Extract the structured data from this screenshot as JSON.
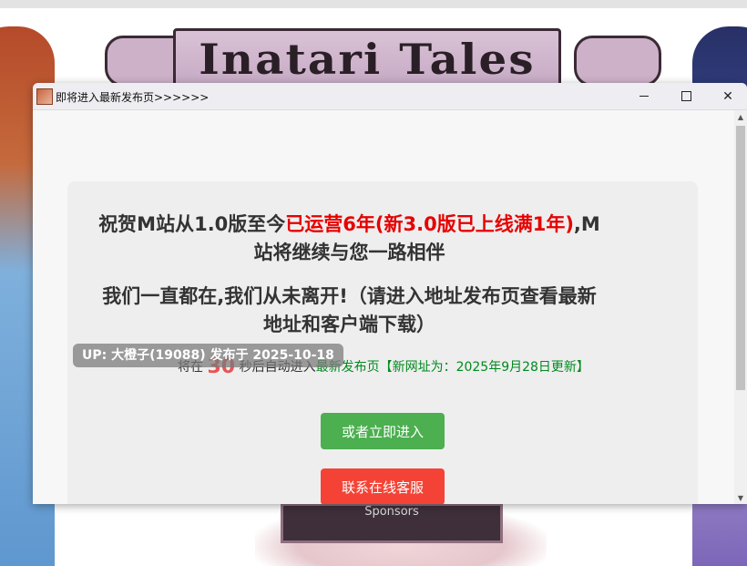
{
  "background": {
    "banner_title": "Inatari Tales",
    "bottom_text": "Sponsors"
  },
  "window": {
    "title": "即将进入最新发布页>>>>>>",
    "controls": {
      "minimize": "–",
      "maximize": "□",
      "close": "✕"
    }
  },
  "content": {
    "headline1_a": "祝贺M站从1.0版至今",
    "headline1_b": "已运营6年(新3.0版已上线满1年)",
    "headline1_c": ",M站将继续与您一路相伴",
    "headline2": "我们一直都在,我们从未离开!（请进入地址发布页查看最新地址和客户端下载）",
    "countdown_prefix": "将在 ",
    "countdown_value": "30",
    "countdown_suffix": " 秒后自动进入",
    "countdown_link": "最新发布页【新网址为：2025年9月28日更新】",
    "enter_button": "或者立即进入",
    "service_button": "联系在线客服"
  },
  "tooltip": {
    "text": "UP: 大橙子(19088) 发布于 2025-10-18"
  },
  "colors": {
    "highlight_red": "#e60000",
    "link_green": "#008a1e",
    "enter_green": "#4caf50",
    "service_red": "#f44336"
  },
  "icons": [
    "favicon-icon",
    "minimize-icon",
    "maximize-icon",
    "close-icon",
    "scroll-up-icon",
    "scroll-down-icon"
  ]
}
